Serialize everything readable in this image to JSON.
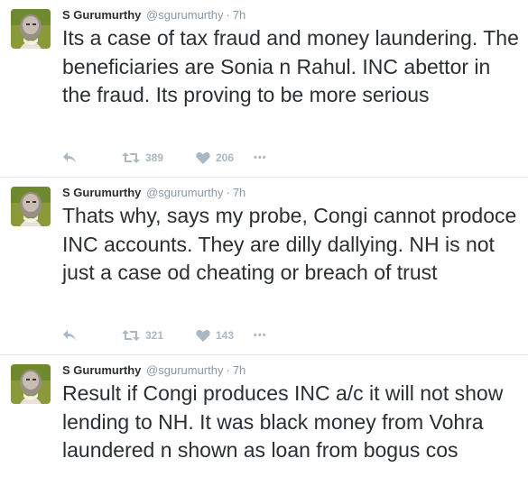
{
  "tweets": [
    {
      "author_name": "S Gurumurthy",
      "handle": "@sgurumurthy",
      "separator": "·",
      "time": "7h",
      "text": "Its a case of tax fraud and money laundering. The beneficiaries are Sonia n Rahul. INC abettor in the fraud. Its proving to be more serious",
      "retweets": "389",
      "likes": "206",
      "more": "•••"
    },
    {
      "author_name": "S Gurumurthy",
      "handle": "@sgurumurthy",
      "separator": "·",
      "time": "7h",
      "text": "Thats why, says my probe, Congi cannot prodoce INC accounts. They are dilly dallying. NH is not just a case od cheating or breach of trust",
      "retweets": "321",
      "likes": "143",
      "more": "•••"
    },
    {
      "author_name": "S Gurumurthy",
      "handle": "@sgurumurthy",
      "separator": "·",
      "time": "7h",
      "text": "Result if Congi produces INC a/c it will not show lending to NH. It was black money from Vohra laundered n shown as loan from bogus cos"
    }
  ],
  "colors": {
    "text": "#292f33",
    "muted": "#8899a6",
    "icon": "#aab8c2",
    "divider": "#e1e8ed"
  },
  "icons": [
    "reply-icon",
    "retweet-icon",
    "heart-icon",
    "more-icon"
  ]
}
